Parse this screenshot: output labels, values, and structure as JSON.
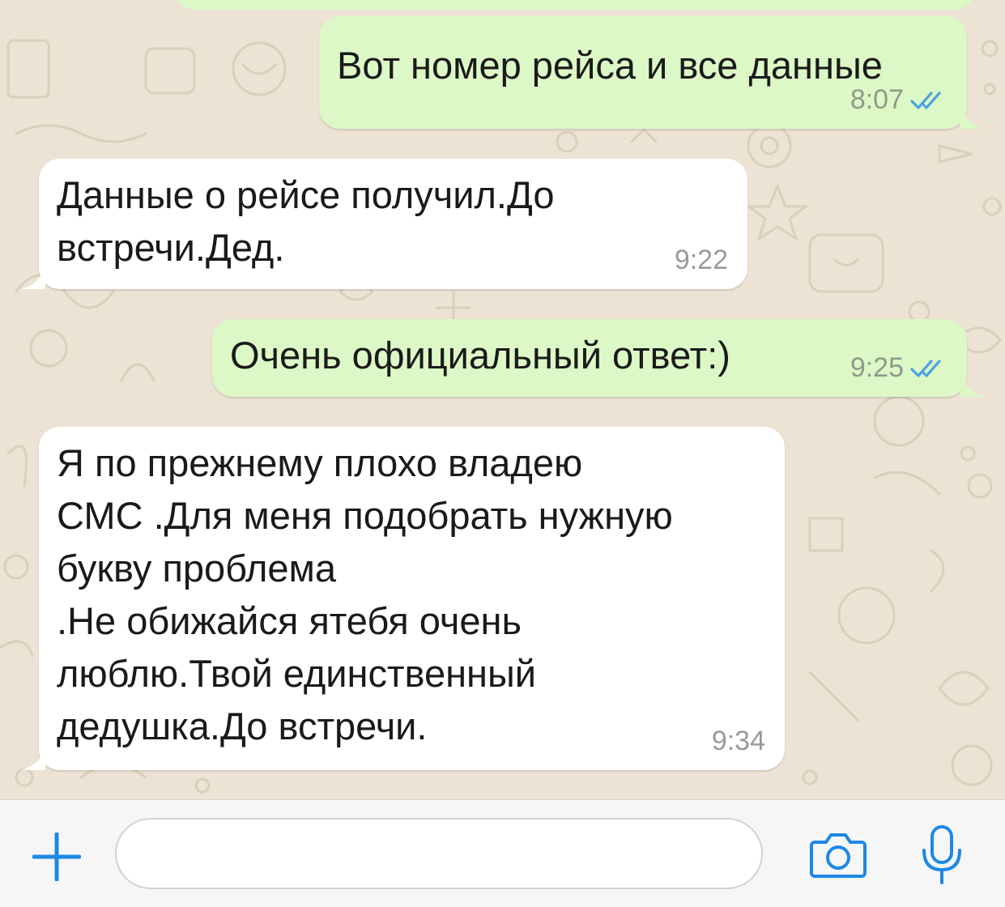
{
  "messages": [
    {
      "direction": "out",
      "text": "Вот номер рейса и все данные",
      "time": "8:07",
      "status": "read"
    },
    {
      "direction": "in",
      "text": "Данные о рейсе получил.До\nвстречи.Дед.",
      "time": "9:22"
    },
    {
      "direction": "out",
      "text": "Очень официальный ответ:)",
      "time": "9:25",
      "status": "read"
    },
    {
      "direction": "in",
      "text": "Я по прежнему плохо владею\nСМС .Для меня подобрать нужную\nбукву проблема\n.Не обижайся ятебя очень\nлюблю.Твой  единственный\nдедушка.До встречи.",
      "time": "9:34"
    }
  ],
  "input_bar": {
    "message_value": "",
    "icons": [
      "plus-icon",
      "camera-icon",
      "microphone-icon"
    ]
  },
  "colors": {
    "wallpaper": "#ece3d4",
    "outgoing_bubble": "#dcf8c6",
    "incoming_bubble": "#ffffff",
    "read_ticks": "#4fa3e0",
    "accent": "#1e88e5"
  }
}
